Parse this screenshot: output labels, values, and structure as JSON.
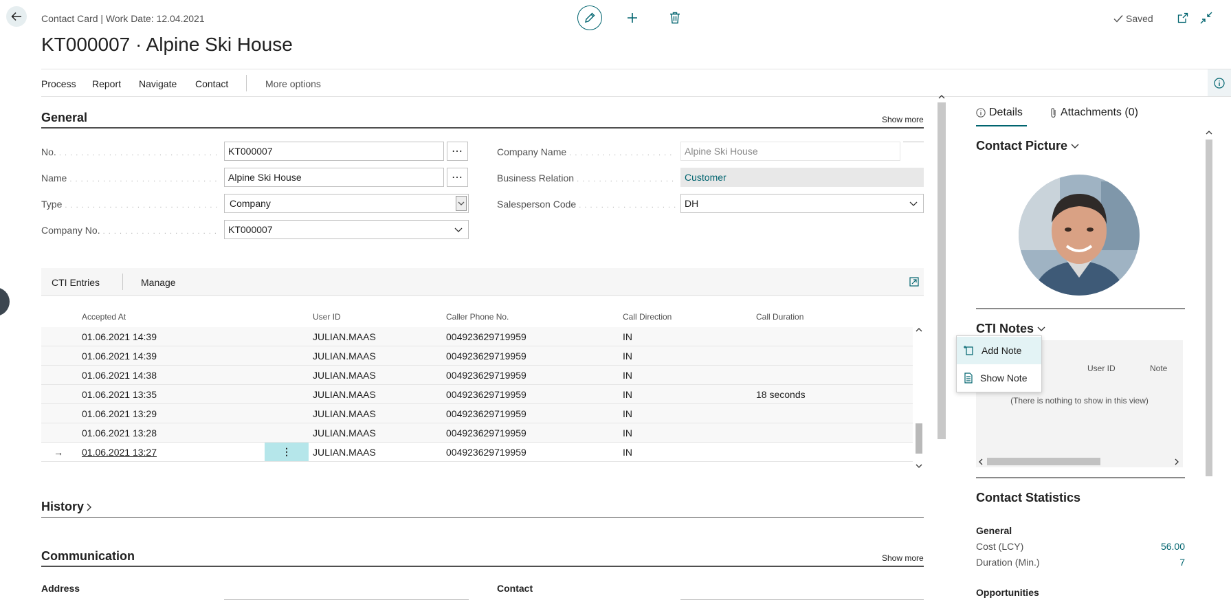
{
  "header": {
    "breadcrumb": "Contact Card | Work Date: 12.04.2021",
    "title": "KT000007 · Alpine Ski House",
    "saved_label": "Saved"
  },
  "actions": [
    "Process",
    "Report",
    "Navigate",
    "Contact",
    "More options"
  ],
  "general": {
    "title": "General",
    "show_more": "Show more",
    "no_label": "No.",
    "no_value": "KT000007",
    "name_label": "Name",
    "name_value": "Alpine Ski House",
    "type_label": "Type",
    "type_value": "Company",
    "company_no_label": "Company No.",
    "company_no_value": "KT000007",
    "company_name_label": "Company Name",
    "company_name_value": "Alpine Ski House",
    "business_relation_label": "Business Relation",
    "business_relation_value": "Customer",
    "salesperson_label": "Salesperson Code",
    "salesperson_value": "DH"
  },
  "cti": {
    "tab_label": "CTI Entries",
    "manage_label": "Manage",
    "columns": [
      "Accepted At",
      "User ID",
      "Caller Phone No.",
      "Call Direction",
      "Call Duration"
    ],
    "rows": [
      {
        "accepted": "01.06.2021 14:39",
        "user": "JULIAN.MAAS",
        "phone": "004923629719959",
        "direction": "IN",
        "duration": ""
      },
      {
        "accepted": "01.06.2021 14:39",
        "user": "JULIAN.MAAS",
        "phone": "004923629719959",
        "direction": "IN",
        "duration": ""
      },
      {
        "accepted": "01.06.2021 14:38",
        "user": "JULIAN.MAAS",
        "phone": "004923629719959",
        "direction": "IN",
        "duration": ""
      },
      {
        "accepted": "01.06.2021 13:35",
        "user": "JULIAN.MAAS",
        "phone": "004923629719959",
        "direction": "IN",
        "duration": "18 seconds"
      },
      {
        "accepted": "01.06.2021 13:29",
        "user": "JULIAN.MAAS",
        "phone": "004923629719959",
        "direction": "IN",
        "duration": ""
      },
      {
        "accepted": "01.06.2021 13:28",
        "user": "JULIAN.MAAS",
        "phone": "004923629719959",
        "direction": "IN",
        "duration": ""
      },
      {
        "accepted": "01.06.2021 13:27",
        "user": "JULIAN.MAAS",
        "phone": "004923629719959",
        "direction": "IN",
        "duration": ""
      }
    ]
  },
  "history": {
    "title": "History"
  },
  "communication": {
    "title": "Communication",
    "show_more": "Show more",
    "address_label": "Address",
    "contact_label": "Contact"
  },
  "factbox": {
    "details_tab": "Details",
    "attachments_tab": "Attachments (0)",
    "contact_picture_title": "Contact Picture",
    "cti_notes_title": "CTI Notes",
    "notes_col_user": "User ID",
    "notes_col_note": "Note",
    "notes_empty": "(There is nothing to show in this view)",
    "popup_add": "Add Note",
    "popup_show": "Show Note",
    "stats_title": "Contact Statistics",
    "stats_general": "General",
    "cost_label": "Cost (LCY)",
    "cost_value": "56.00",
    "duration_label": "Duration (Min.)",
    "duration_value": "7",
    "opportunities": "Opportunities"
  },
  "colors": {
    "accent": "#00646f",
    "row_highlight": "#b5e6ea"
  }
}
